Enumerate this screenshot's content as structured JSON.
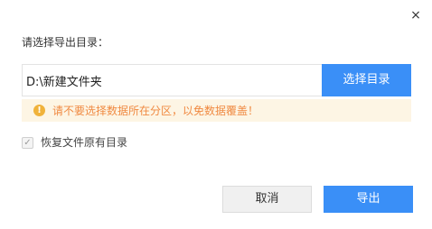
{
  "dialog": {
    "close_icon": "×",
    "prompt": "请选择导出目录：",
    "path_value": "D:\\新建文件夹",
    "choose_dir_label": "选择目录",
    "warning": {
      "icon": "!",
      "text": "请不要选择数据所在分区，以免数据覆盖！"
    },
    "restore_checkbox": {
      "checked": true,
      "check_mark": "✓",
      "label": "恢复文件原有目录"
    },
    "cancel_label": "取消",
    "export_label": "导出"
  },
  "colors": {
    "accent": "#3a8ff7",
    "warning_bg": "#fdf5e4",
    "warning_text": "#f08a42",
    "warning_icon": "#f0b23a"
  }
}
